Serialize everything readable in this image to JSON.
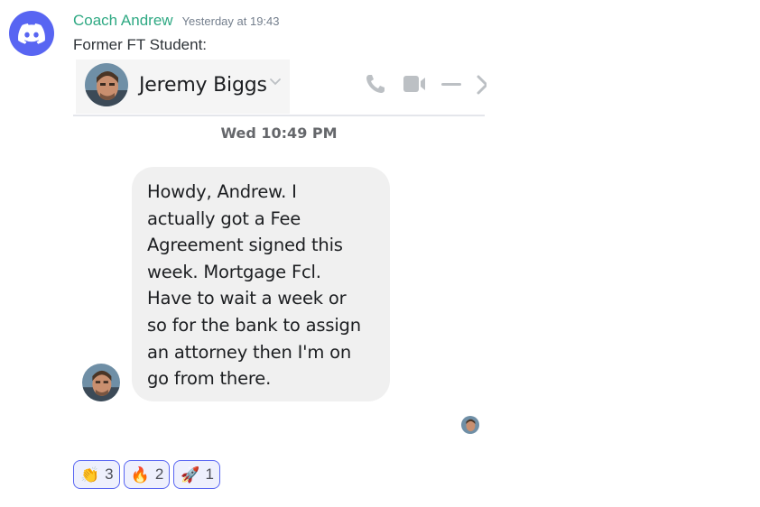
{
  "message": {
    "author": "Coach Andrew",
    "timestamp": "Yesterday at 19:43",
    "text": "Former FT Student:"
  },
  "screenshot": {
    "contact_name": "Jeremy Biggs",
    "header_icons": [
      "chevron-down-icon",
      "phone-icon",
      "video-icon",
      "minimize-icon",
      "close-icon"
    ],
    "date_separator": "Wed 10:49 PM",
    "bubble_text": "Howdy, Andrew. I\nactually got a Fee\nAgreement signed this\nweek. Mortgage Fcl.\nHave to wait a week or\nso for the bank to assign\nan attorney then I'm on\ngo from there."
  },
  "reactions": [
    {
      "emoji": "👏",
      "icon": "clapping-hands-icon",
      "count": "3"
    },
    {
      "emoji": "🔥",
      "icon": "fire-icon",
      "count": "2"
    },
    {
      "emoji": "🚀",
      "icon": "rocket-icon",
      "count": "1"
    }
  ],
  "colors": {
    "discord_blurple": "#5865f2",
    "author": "#2fa983",
    "bubble": "#f0f0f0"
  }
}
